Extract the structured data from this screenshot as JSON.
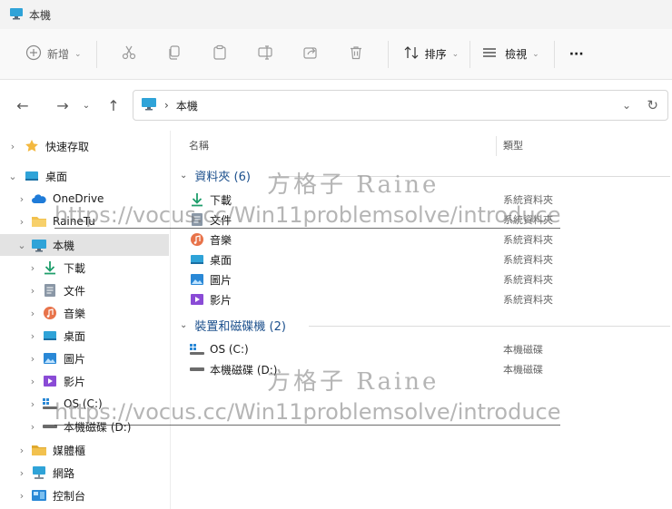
{
  "window": {
    "title": "本機"
  },
  "toolbar": {
    "new_label": "新增",
    "sort_label": "排序",
    "view_label": "檢視",
    "more_label": "···"
  },
  "address": {
    "crumb": "本機"
  },
  "sidebar": {
    "items": [
      {
        "label": "快速存取",
        "icon": "star-icon"
      },
      {
        "label": "桌面",
        "icon": "desktop-icon"
      },
      {
        "label": "OneDrive",
        "icon": "cloud-icon"
      },
      {
        "label": "RaineTu",
        "icon": "folder-icon"
      },
      {
        "label": "本機",
        "icon": "pc-icon"
      },
      {
        "label": "下載",
        "icon": "download-icon"
      },
      {
        "label": "文件",
        "icon": "document-icon"
      },
      {
        "label": "音樂",
        "icon": "music-icon"
      },
      {
        "label": "桌面",
        "icon": "desktop-icon"
      },
      {
        "label": "圖片",
        "icon": "picture-icon"
      },
      {
        "label": "影片",
        "icon": "video-icon"
      },
      {
        "label": "OS (C:)",
        "icon": "os-drive-icon"
      },
      {
        "label": "本機磁碟 (D:)",
        "icon": "drive-icon"
      },
      {
        "label": "媒體櫃",
        "icon": "library-icon"
      },
      {
        "label": "網路",
        "icon": "network-icon"
      },
      {
        "label": "控制台",
        "icon": "control-panel-icon"
      }
    ]
  },
  "main": {
    "columns": {
      "name": "名稱",
      "type": "類型"
    },
    "groups": [
      {
        "title": "資料夾 (6)",
        "items": [
          {
            "name": "下載",
            "type": "系統資料夾",
            "icon": "download-icon"
          },
          {
            "name": "文件",
            "type": "系統資料夾",
            "icon": "document-icon"
          },
          {
            "name": "音樂",
            "type": "系統資料夾",
            "icon": "music-icon"
          },
          {
            "name": "桌面",
            "type": "系統資料夾",
            "icon": "desktop-icon"
          },
          {
            "name": "圖片",
            "type": "系統資料夾",
            "icon": "picture-icon"
          },
          {
            "name": "影片",
            "type": "系統資料夾",
            "icon": "video-icon"
          }
        ]
      },
      {
        "title": "裝置和磁碟機 (2)",
        "items": [
          {
            "name": "OS (C:)",
            "type": "本機磁碟",
            "icon": "os-drive-icon"
          },
          {
            "name": "本機磁碟 (D:)",
            "type": "本機磁碟",
            "icon": "drive-icon"
          }
        ]
      }
    ]
  },
  "watermark": {
    "author": "方格子 Raine",
    "url": "https://vocus.cc/Win11problemsolve/introduce"
  },
  "colors": {
    "accent": "#1b4f8c",
    "selected": "#e3e3e3",
    "folder": "#f2c14e",
    "pc": "#2fa3d8"
  }
}
